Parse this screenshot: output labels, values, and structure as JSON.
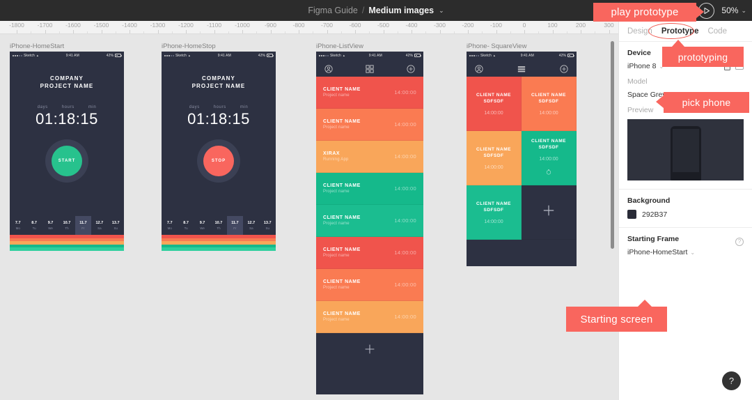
{
  "topbar": {
    "breadcrumb": "Figma Guide",
    "separator": "/",
    "page": "Medium images",
    "caret": "⌄",
    "play_icon": "play-icon",
    "zoom_level": "50%",
    "zoom_caret": "⌄"
  },
  "ruler": {
    "ticks": [
      "-1800",
      "-1700",
      "-1600",
      "-1500",
      "-1400",
      "-1300",
      "-1200",
      "-1100",
      "-1000",
      "-900",
      "-800",
      "-700",
      "-600",
      "-500",
      "-400",
      "-300",
      "-200",
      "-100",
      "0",
      "100",
      "200",
      "300"
    ]
  },
  "frames": [
    {
      "label": "iPhone-HomeStart",
      "type": "home",
      "statusbar": {
        "carrier": "Sketch",
        "time": "9:41 AM",
        "battery": "42%"
      },
      "title_line1": "COMPANY",
      "title_line2": "PROJECT NAME",
      "timer_labels": [
        "days",
        "hours",
        "min"
      ],
      "timer_value": "01:18:15",
      "button_label": "START",
      "button_color": "#27c28d",
      "dates": [
        {
          "num": "7.7",
          "day": "Mo",
          "selected": false
        },
        {
          "num": "8.7",
          "day": "Tu",
          "selected": false
        },
        {
          "num": "9.7",
          "day": "We",
          "selected": false
        },
        {
          "num": "10.7",
          "day": "Th",
          "selected": false
        },
        {
          "num": "11.7",
          "day": "Fr",
          "selected": true
        },
        {
          "num": "12.7",
          "day": "Sa",
          "selected": false
        },
        {
          "num": "13.7",
          "day": "Su",
          "selected": false
        }
      ],
      "stripes": [
        "#f0544c",
        "#f97a52",
        "#f9a65a",
        "#15b98b",
        "#2ecf9d"
      ]
    },
    {
      "label": "iPhone-HomeStop",
      "type": "home",
      "statusbar": {
        "carrier": "Sketch",
        "time": "9:41 AM",
        "battery": "42%"
      },
      "title_line1": "COMPANY",
      "title_line2": "PROJECT NAME",
      "timer_labels": [
        "days",
        "hours",
        "min"
      ],
      "timer_value": "01:18:15",
      "button_label": "STOP",
      "button_color": "#f9665e",
      "dates": [
        {
          "num": "7.7",
          "day": "Mo",
          "selected": false
        },
        {
          "num": "8.7",
          "day": "Tu",
          "selected": false
        },
        {
          "num": "9.7",
          "day": "We",
          "selected": false
        },
        {
          "num": "10.7",
          "day": "Th",
          "selected": false
        },
        {
          "num": "11.7",
          "day": "Fr",
          "selected": true
        },
        {
          "num": "12.7",
          "day": "Sa",
          "selected": false
        },
        {
          "num": "13.7",
          "day": "Su",
          "selected": false
        }
      ],
      "stripes": [
        "#f0544c",
        "#f97a52",
        "#f9a65a",
        "#15b98b",
        "#2ecf9d"
      ]
    },
    {
      "label": "iPhone-ListView",
      "type": "list",
      "statusbar": {
        "carrier": "Sketch",
        "time": "9:41 AM",
        "battery": "42%"
      },
      "nav": {
        "left_icon": "profile-icon",
        "center_icon": "grid-view-icon",
        "right_icon": "add-circle-icon"
      },
      "rows": [
        {
          "name": "CLIENT NAME",
          "sub": "Project name",
          "time": "14:00:00",
          "color": "#f0544c"
        },
        {
          "name": "CLIENT NAME",
          "sub": "Project name",
          "time": "14:00:00",
          "color": "#fa7b52"
        },
        {
          "name": "XIRAX",
          "sub": "Running App",
          "time": "14:00:00",
          "color": "#f9a65a"
        },
        {
          "name": "CLIENT NAME",
          "sub": "Project name",
          "time": "14:00:00",
          "color": "#15b98b"
        },
        {
          "name": "CLIENT NAME",
          "sub": "Project name",
          "time": "14:00:00",
          "color": "#1bbd90"
        },
        {
          "name": "CLIENT NAME",
          "sub": "Project name",
          "time": "14:00:00",
          "color": "#f0544c"
        },
        {
          "name": "CLIENT NAME",
          "sub": "Project name",
          "time": "14:00:00",
          "color": "#fa7b52"
        },
        {
          "name": "CLIENT NAME",
          "sub": "Project name",
          "time": "14:00:00",
          "color": "#f9a65a"
        }
      ],
      "add_row_icon": "plus-icon"
    },
    {
      "label": "iPhone- SquareView",
      "type": "square",
      "statusbar": {
        "carrier": "Sketch",
        "time": "9:41 AM",
        "battery": "42%"
      },
      "nav": {
        "left_icon": "profile-icon",
        "center_icon": "list-view-icon",
        "right_icon": "add-circle-icon"
      },
      "cells": [
        {
          "name": "CLIENT NAME SDFSDF",
          "time": "14:00:00",
          "color": "#f0544c",
          "timer_icon": false
        },
        {
          "name": "CLIENT NAME SDFSDF",
          "time": "14:00:00",
          "color": "#fa7b52",
          "timer_icon": false
        },
        {
          "name": "CLIENT NAME SDFSDF",
          "time": "14:00:00",
          "color": "#f9a65a",
          "timer_icon": false
        },
        {
          "name": "CLIENT NAME SDFSDF",
          "time": "14:00:00",
          "color": "#15b98b",
          "timer_icon": true
        },
        {
          "name": "CLIENT NAME SDFSDF",
          "time": "14:00:00",
          "color": "#1bbd90",
          "timer_icon": false
        },
        {
          "name": "",
          "time": "",
          "color": "#2d3142",
          "timer_icon": false
        }
      ],
      "add_cell_icon": "plus-icon"
    }
  ],
  "panel": {
    "tabs": [
      {
        "label": "Design",
        "active": false
      },
      {
        "label": "Prototype",
        "active": true
      },
      {
        "label": "Code",
        "active": false
      }
    ],
    "device": {
      "label": "Device",
      "value": "iPhone 8",
      "caret": "⌄",
      "orientation_portrait_icon": "orientation-portrait-icon",
      "orientation_landscape_icon": "orientation-landscape-icon"
    },
    "model": {
      "label": "Model",
      "value": "Space Grey",
      "caret": "⌄"
    },
    "preview": {
      "label": "Preview"
    },
    "background": {
      "label": "Background",
      "hex": "292B37",
      "swatch_color": "#292B37"
    },
    "starting_frame": {
      "label": "Starting Frame",
      "value": "iPhone-HomeStart",
      "caret": "⌄",
      "help_icon": "question-mark-icon"
    }
  },
  "help_fab": {
    "icon": "question-mark-icon",
    "label": "?"
  },
  "callouts": [
    {
      "id": "play",
      "text": "play prototype"
    },
    {
      "id": "proto",
      "text": "prototyping"
    },
    {
      "id": "pick",
      "text": "pick phone"
    },
    {
      "id": "start",
      "text": "Starting screen"
    }
  ]
}
